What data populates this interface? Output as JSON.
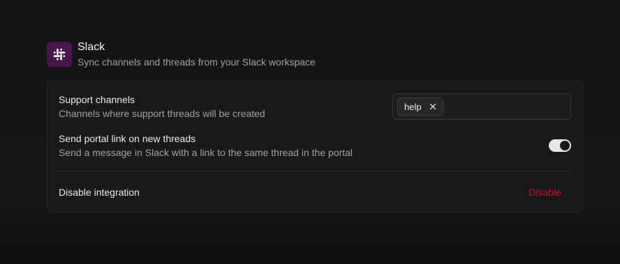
{
  "integration": {
    "name": "Slack",
    "description": "Sync channels and threads from your Slack workspace",
    "logo_icon": "slack-logo",
    "brand_color": "#4a154b"
  },
  "settings": {
    "support_channels": {
      "title": "Support channels",
      "description": "Channels where support threads will be created",
      "selected_channels": [
        "help"
      ],
      "remove_icon": "close-icon"
    },
    "portal_link": {
      "title": "Send portal link on new threads",
      "description": "Send a message in Slack with a link to the same thread in the portal",
      "enabled": true
    },
    "disable": {
      "title": "Disable integration",
      "button_label": "Disable",
      "button_color": "#c8102e"
    }
  }
}
